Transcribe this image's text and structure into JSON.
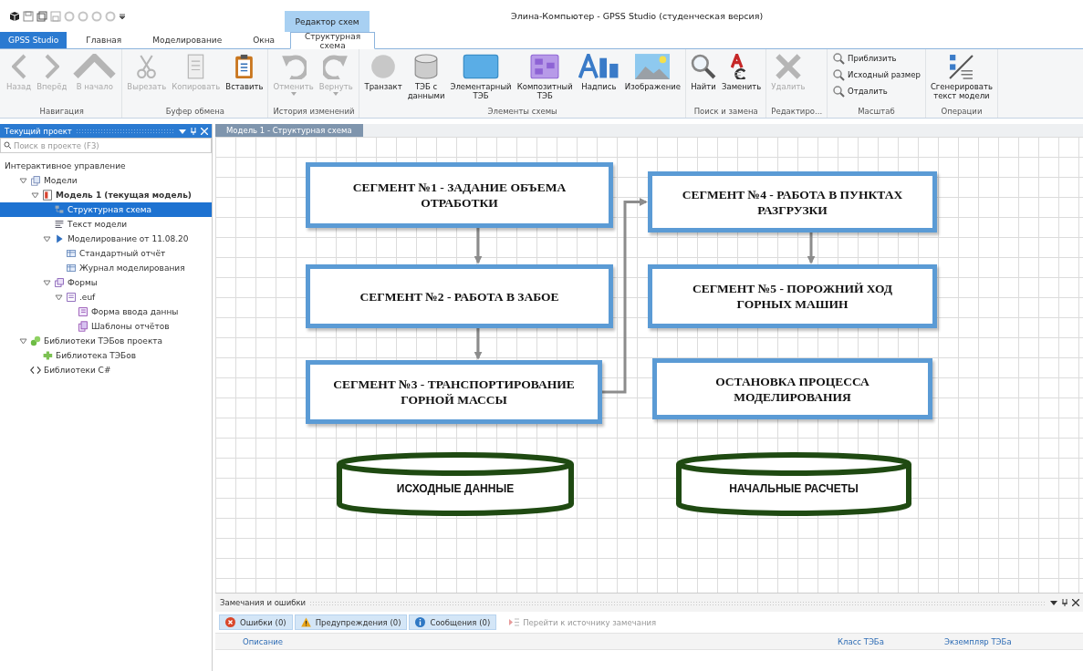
{
  "window": {
    "title": "Элина-Компьютер - GPSS Studio (студенческая версия)",
    "context_tab": "Редактор схем"
  },
  "tabs": [
    {
      "label": "GPSS Studio",
      "kind": "app",
      "selected": false
    },
    {
      "label": "Главная",
      "kind": "tab",
      "selected": false
    },
    {
      "label": "Моделирование",
      "kind": "tab",
      "selected": false
    },
    {
      "label": "Окна",
      "kind": "tab",
      "selected": false
    },
    {
      "label": "Структурная схема",
      "kind": "tab",
      "selected": true
    }
  ],
  "ribbon": [
    {
      "label": "Навигация",
      "kind": "large",
      "items": [
        {
          "label": "Назад",
          "kind": "back",
          "disabled": true
        },
        {
          "label": "Вперёд",
          "kind": "forward",
          "disabled": true
        },
        {
          "label": "В начало",
          "kind": "up",
          "disabled": true
        }
      ]
    },
    {
      "label": "Буфер обмена",
      "kind": "large",
      "items": [
        {
          "label": "Вырезать",
          "kind": "cut",
          "disabled": true
        },
        {
          "label": "Копировать",
          "kind": "copy",
          "disabled": true
        },
        {
          "label": "Вставить",
          "kind": "paste",
          "disabled": false
        }
      ]
    },
    {
      "label": "История изменений",
      "kind": "large",
      "items": [
        {
          "label": "Отменить",
          "kind": "undo",
          "disabled": true,
          "dropdown": true
        },
        {
          "label": "Вернуть",
          "kind": "redo",
          "disabled": true,
          "dropdown": true
        }
      ]
    },
    {
      "label": "Элементы схемы",
      "kind": "large",
      "items": [
        {
          "label": "Транзакт",
          "kind": "circle",
          "disabled": false
        },
        {
          "label": "ТЭБ с\nданными",
          "kind": "db",
          "disabled": false
        },
        {
          "label": "Элементарный\nТЭБ",
          "kind": "block",
          "disabled": false
        },
        {
          "label": "Композитный\nТЭБ",
          "kind": "composite",
          "disabled": false
        },
        {
          "label": "Надпись",
          "kind": "abc",
          "disabled": false
        },
        {
          "label": "Изображение",
          "kind": "image",
          "disabled": false
        }
      ]
    },
    {
      "label": "Поиск и замена",
      "kind": "large",
      "items": [
        {
          "label": "Найти",
          "kind": "find",
          "disabled": false
        },
        {
          "label": "Заменить",
          "kind": "replace",
          "disabled": false
        }
      ]
    },
    {
      "label": "Редактиро...",
      "kind": "large",
      "items": [
        {
          "label": "Удалить",
          "kind": "delete",
          "disabled": true
        }
      ]
    },
    {
      "label": "Масштаб",
      "kind": "small",
      "items": [
        {
          "label": "Приблизить",
          "kind": "zoom",
          "disabled": false
        },
        {
          "label": "Исходный размер",
          "kind": "zoom",
          "disabled": false
        },
        {
          "label": "Отдалить",
          "kind": "zoom",
          "disabled": false
        }
      ]
    },
    {
      "label": "Операции",
      "kind": "large",
      "items": [
        {
          "label": "Сгенерировать\nтекст модели",
          "kind": "generate",
          "disabled": false
        }
      ]
    }
  ],
  "project_panel": {
    "title": "Текущий проект",
    "search": {
      "placeholder": "Поиск в проекте (F3)"
    },
    "tree": [
      {
        "label": "Интерактивное управление",
        "current": false,
        "selected": false,
        "children": [
          {
            "label": "Модели",
            "kind": "models",
            "current": false,
            "selected": false,
            "expanded": true,
            "children": [
              {
                "label": "Модель 1 (текущая модель)",
                "kind": "model",
                "current": true,
                "selected": false,
                "expanded": true,
                "children": [
                  {
                    "label": "Структурная схема",
                    "kind": "diagram",
                    "current": false,
                    "selected": true
                  },
                  {
                    "label": "Текст модели",
                    "kind": "text",
                    "current": false,
                    "selected": false
                  },
                  {
                    "label": "Моделирование от 11.08.20",
                    "kind": "run",
                    "current": false,
                    "selected": false,
                    "expanded": true,
                    "children": [
                      {
                        "label": "Стандартный отчёт",
                        "kind": "report",
                        "current": false,
                        "selected": false
                      },
                      {
                        "label": "Журнал моделирования",
                        "kind": "report",
                        "current": false,
                        "selected": false
                      }
                    ]
                  },
                  {
                    "label": "Формы",
                    "kind": "forms",
                    "current": false,
                    "selected": false,
                    "expanded": true,
                    "children": [
                      {
                        "label": ".euf",
                        "kind": "formfile",
                        "current": false,
                        "selected": false,
                        "expanded": true,
                        "children": [
                          {
                            "label": "Форма ввода данны",
                            "kind": "form",
                            "current": false,
                            "selected": false
                          },
                          {
                            "label": "Шаблоны отчётов",
                            "kind": "template",
                            "current": false,
                            "selected": false
                          }
                        ]
                      }
                    ]
                  }
                ]
              }
            ]
          },
          {
            "label": "Библиотеки ТЭБов проекта",
            "kind": "libs",
            "current": false,
            "selected": false,
            "expanded": true,
            "children": [
              {
                "label": "Библиотека ТЭБов",
                "kind": "lib",
                "current": false,
                "selected": false
              }
            ]
          },
          {
            "label": "Библиотеки C#",
            "kind": "code",
            "current": false,
            "selected": false
          }
        ]
      }
    ]
  },
  "document_tab": {
    "label": "Модель 1 - Структурная схема",
    "selected": false
  },
  "diagram": {
    "nodes": [
      {
        "kind": "segment",
        "text": "СЕГМЕНТ №1 - ЗАДАНИЕ ОБЪЕМА ОТРАБОТКИ"
      },
      {
        "kind": "segment",
        "text": "СЕГМЕНТ №2 - РАБОТА В ЗАБОЕ"
      },
      {
        "kind": "segment",
        "text": "СЕГМЕНТ №3 - ТРАНСПОРТИРОВАНИЕ ГОРНОЙ МАССЫ"
      },
      {
        "kind": "database",
        "text": "ИСХОДНЫЕ ДАННЫЕ"
      },
      {
        "kind": "segment",
        "text": "СЕГМЕНТ №4 - РАБОТА В ПУНКТАХ РАЗГРУЗКИ"
      },
      {
        "kind": "segment",
        "text": "СЕГМЕНТ №5 - ПОРОЖНИЙ ХОД ГОРНЫХ МАШИН"
      },
      {
        "kind": "segment",
        "text": "ОСТАНОВКА ПРОЦЕССА МОДЕЛИРОВАНИЯ"
      },
      {
        "kind": "database",
        "text": "НАЧАЛЬНЫЕ РАСЧЕТЫ"
      }
    ]
  },
  "messages_panel": {
    "title": "Замечания и ошибки",
    "filters": [
      {
        "label": "Ошибки (0)",
        "kind": "error",
        "selected": true
      },
      {
        "label": "Предупреждения (0)",
        "kind": "warning",
        "selected": true
      },
      {
        "label": "Сообщения (0)",
        "kind": "info",
        "selected": true
      }
    ],
    "goto": {
      "label": "Перейти к источнику замечания",
      "disabled": true
    },
    "columns": [
      "Описание",
      "Класс ТЭБа",
      "Экземпляр ТЭБа"
    ]
  }
}
